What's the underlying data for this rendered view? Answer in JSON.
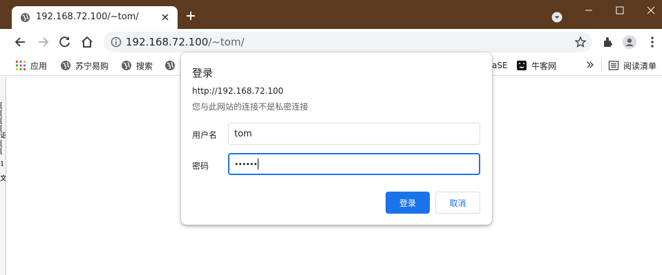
{
  "browser": {
    "tab": {
      "title": "192.168.72.100/~tom/"
    },
    "omnibox": {
      "host": "192.168.72.100",
      "path": "/~tom/"
    },
    "bookmarks": [
      {
        "label": "应用",
        "icon": "apps-grid-icon"
      },
      {
        "label": "苏宁易购",
        "icon": "globe-icon"
      },
      {
        "label": "搜索",
        "icon": "globe-icon"
      },
      {
        "label": "aSE",
        "icon": "page-icon"
      },
      {
        "label": "牛客网",
        "icon": "nowcoder-icon"
      }
    ],
    "reading_list": "阅读清单",
    "colors": {
      "frame": "#5b3a1f",
      "accent": "#1a73e8"
    }
  },
  "left_strip": [
    "[",
    "[",
    "[",
    "[",
    "诏",
    "[",
    "[",
    "1",
    "",
    "文"
  ],
  "dialog": {
    "title": "登录",
    "host": "http://192.168.72.100",
    "warning": "您与此网站的连接不是私密连接",
    "username_label": "用户名",
    "username_value": "tom",
    "password_label": "密码",
    "password_mask": "••••••",
    "login_button": "登录",
    "cancel_button": "取消"
  }
}
